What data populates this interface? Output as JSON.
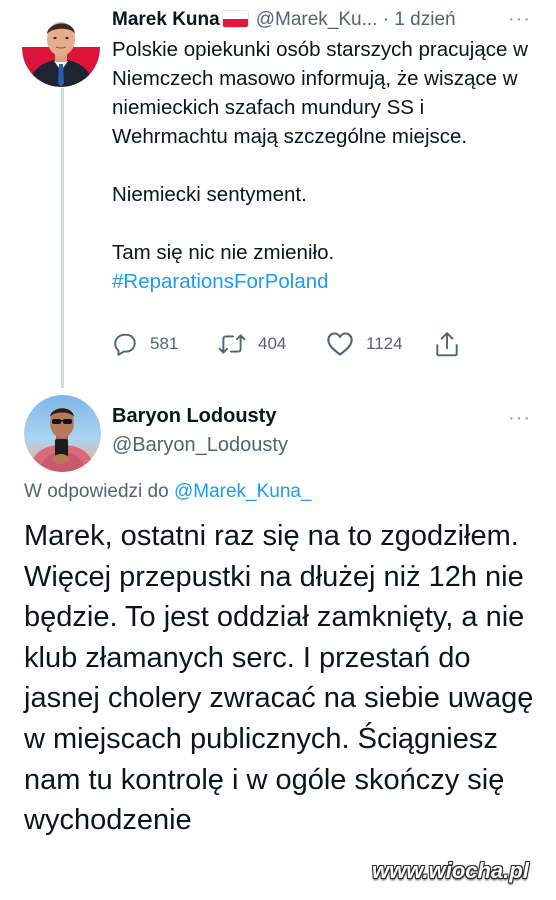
{
  "tweet1": {
    "author_name": "Marek Kuna",
    "flag_icon": "poland-flag-icon",
    "handle": "@Marek_Ku...",
    "separator": "·",
    "time": "1 dzień",
    "more_icon": "···",
    "text_lines": {
      "p1": "Polskie opiekunki osób starszych pracujące w Niemczech masowo informują, że wiszące w niemieckich szafach mundury SS i Wehrmachtu mają szczególne miejsce.",
      "p2": "Niemiecki sentyment.",
      "p3": "Tam się nic nie zmieniło."
    },
    "hashtag": "#ReparationsForPoland",
    "replies": "581",
    "retweets": "404",
    "likes": "1124"
  },
  "tweet2": {
    "author_name": "Baryon Lodousty",
    "handle": "@Baryon_Lodousty",
    "more_icon": "···",
    "reply_prefix": "W odpowiedzi do",
    "reply_mention": "@Marek_Kuna_",
    "text": "Marek, ostatni raz się na to zgodziłem. Więcej przepustki na dłużej niż 12h nie będzie. To jest oddział zamknięty, a nie klub złamanych serc. I przestań do jasnej cholery zwracać na siebie uwagę w miejscach publicznych. Ściągniesz nam tu kontrolę i w ogóle skończy się wychodzenie"
  },
  "watermark": "www.wiocha.pl",
  "colors": {
    "link": "#1d9bf0",
    "secondary_text": "#536471",
    "primary_text": "#0f1419",
    "thread_line": "#cfd9de"
  }
}
